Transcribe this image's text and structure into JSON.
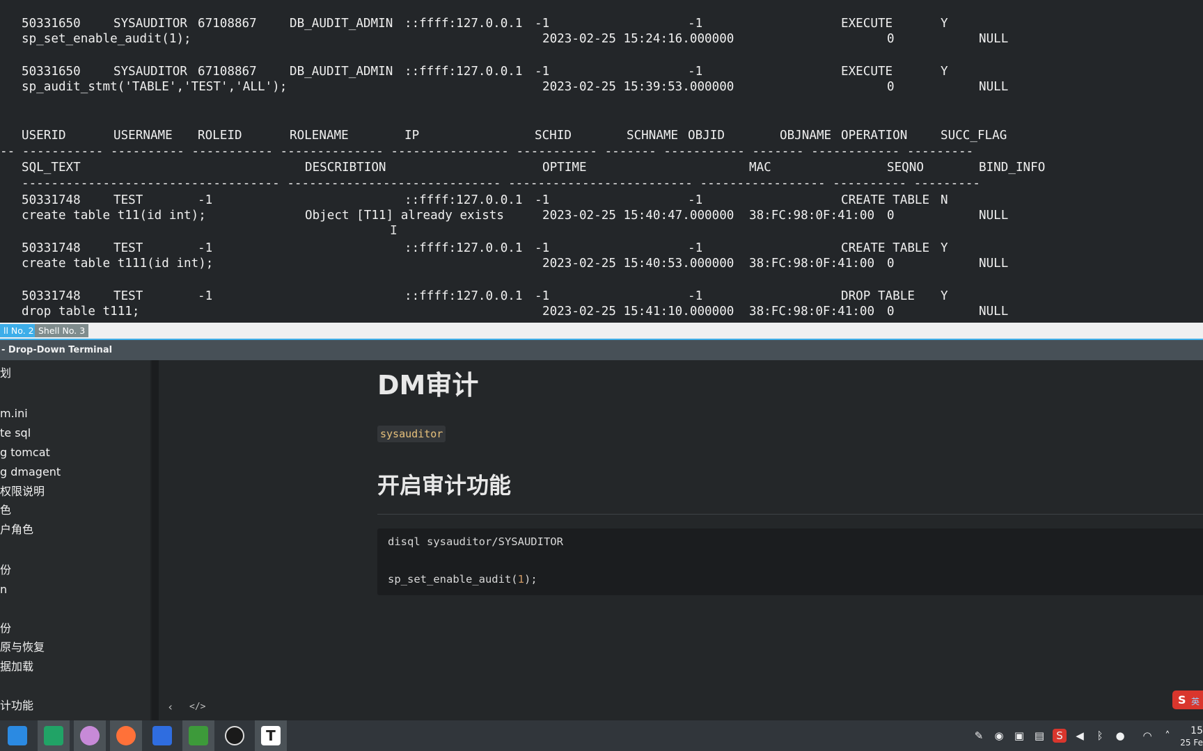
{
  "terminal": {
    "audit_rows": [
      {
        "l1": [
          "50331650",
          "SYSAUDITOR",
          "67108867",
          "DB_AUDIT_ADMIN",
          "::ffff:127.0.0.1",
          "-1",
          "-1",
          "EXECUTE",
          "Y"
        ],
        "l2": [
          "sp_set_enable_audit(1);",
          "2023-02-25 15:24:16.000000",
          "0",
          "NULL"
        ]
      },
      {
        "l1": [
          "50331650",
          "SYSAUDITOR",
          "67108867",
          "DB_AUDIT_ADMIN",
          "::ffff:127.0.0.1",
          "-1",
          "-1",
          "EXECUTE",
          "Y"
        ],
        "l2": [
          "sp_audit_stmt('TABLE','TEST','ALL');",
          "2023-02-25 15:39:53.000000",
          "0",
          "NULL"
        ]
      }
    ],
    "header1": [
      "USERID",
      "USERNAME",
      "ROLEID",
      "ROLENAME",
      "IP",
      "SCHID",
      "SCHNAME",
      "OBJID",
      "OBJNAME",
      "OPERATION",
      "SUCC_FLAG"
    ],
    "dashes1": "-- ----------- ---------- ----------- -------------- ---------------- ----------- ------- ----------- ------- ------------ ---------",
    "header2": [
      "SQL_TEXT",
      "DESCRIBTION",
      "OPTIME",
      "MAC",
      "SEQNO",
      "BIND_INFO"
    ],
    "dashes2": "----------------------------------- ----------------------------- ------------------------- ----------------- ---------- ---------",
    "rows": [
      {
        "l1": [
          "50331748",
          "TEST",
          "-1",
          "::ffff:127.0.0.1",
          "-1",
          "-1",
          "CREATE TABLE",
          "N"
        ],
        "l2": [
          "create table t11(id int);",
          "Object [T11] already exists",
          "2023-02-25 15:40:47.000000",
          "38:FC:98:0F:41:00",
          "0",
          "NULL"
        ]
      },
      {
        "l1": [
          "50331748",
          "TEST",
          "-1",
          "::ffff:127.0.0.1",
          "-1",
          "-1",
          "CREATE TABLE",
          "Y"
        ],
        "l2": [
          "create table t111(id int);",
          "",
          "2023-02-25 15:40:53.000000",
          "38:FC:98:0F:41:00",
          "0",
          "NULL"
        ]
      },
      {
        "l1": [
          "50331748",
          "TEST",
          "-1",
          "::ffff:127.0.0.1",
          "-1",
          "-1",
          "DROP TABLE",
          "Y"
        ],
        "l2": [
          "drop table t111;",
          "",
          "2023-02-25 15:41:10.000000",
          "38:FC:98:0F:41:00",
          "0",
          "NULL"
        ]
      }
    ]
  },
  "tabs": [
    "ll No. 2",
    "Shell No. 3"
  ],
  "window_title": "- Drop-Down Terminal",
  "sidebar": {
    "items": [
      "划",
      "m.ini",
      "te sql",
      "g tomcat",
      "g dmagent",
      "权限说明",
      "色",
      "户角色",
      "份",
      "n",
      "份",
      "原与恢复",
      "据加载",
      "计功能"
    ]
  },
  "doc": {
    "h1": "DM审计",
    "inline_code": "sysauditor",
    "h2": "开启审计功能",
    "code_lines": {
      "l1": "disql sysauditor/SYSAUDITOR",
      "l2a": "sp_set_enable_audit(",
      "l2num": "1",
      "l2b": ");"
    },
    "footer_icons": [
      "chevron-left-icon",
      "code-icon"
    ]
  },
  "ime": {
    "label": "S",
    "sub": "英"
  },
  "taskbar": {
    "apps": [
      "app-launcher",
      "file-manager",
      "image-viewer",
      "firefox",
      "wps-writer",
      "spreadsheet",
      "obs-studio",
      "typora"
    ],
    "clock_time": "15",
    "clock_date": "25 Fe"
  },
  "colors": {
    "terminal_bg": "#232629",
    "accent": "#3daee9",
    "inline_code": "#e6c07b"
  }
}
